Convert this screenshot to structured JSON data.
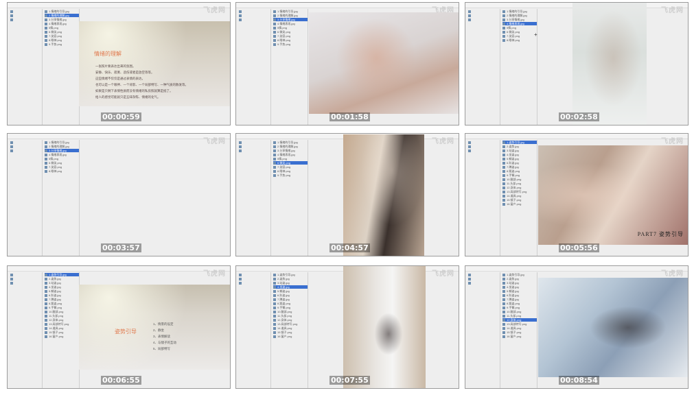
{
  "watermark": "飞虎网",
  "frames": [
    {
      "timestamp": "00:00:59",
      "tree": [
        "1.情绪的引导.jpg",
        "2.情绪的理解.jpg",
        "3.分享情绪.jpg",
        "4.情绪表现.jpg",
        "5情.png",
        "6.微笑.png",
        "7.笑容.png",
        "8.眼神.png",
        "9.手势.png"
      ],
      "slide": {
        "title": "情绪的理解",
        "lines": [
          "一张照片要表达出来的氛围。",
          "安静、快乐、寂寞、悲伤或者是放空等等。",
          "这些情绪不仅仅是通过表情的表达。",
          "也可以是一个眼神、一个背影、一个局部特写、一种气质的散发等。",
          "如果是只剩下表情性质而没有情绪的私房照就算是抵了。",
          "给人的感觉可能就只是五味杂陈、情绪的化气。"
        ]
      }
    },
    {
      "timestamp": "00:01:58",
      "tree": [
        "1.情绪的引导.jpg",
        "2.情绪的理解.jpg",
        "3.分享情绪.jpg",
        "4.情绪表现.jpg",
        "5情.png",
        "6.微笑.png",
        "7.笑容.png",
        "8.眼神.png",
        "9.手势.png"
      ]
    },
    {
      "timestamp": "00:02:58",
      "tree": [
        "1.情绪的引导.jpg",
        "2.情绪的理解.jpg",
        "3.分享情绪.jpg",
        "4.情绪表现.jpg",
        "5情.png",
        "6.微笑.png",
        "7.笑容.png",
        "8.眼神.png"
      ]
    },
    {
      "timestamp": "00:03:57",
      "tree": [
        "1.情绪的引导.jpg",
        "2.情绪的理解.jpg",
        "3.分享情绪.jpg",
        "4.情绪表现.jpg",
        "5情.png",
        "6.微笑.png",
        "7.笑容.png",
        "8.眼神.png"
      ]
    },
    {
      "timestamp": "00:04:57",
      "tree": [
        "1.情绪的引导.jpg",
        "2.情绪的理解.jpg",
        "3.分享情绪.jpg",
        "4.情绪表现.jpg",
        "5情.png",
        "6.微笑.png",
        "7.笑容.png",
        "8.眼神.png",
        "9.手势.png"
      ]
    },
    {
      "timestamp": "00:05:56",
      "tree": [
        "1.姿势引导.jpg",
        "2.姿势.jpg",
        "3.站姿.jpg",
        "4.坐姿.jpg",
        "5.躺姿.jpg",
        "6.趴姿.jpg",
        "7.蹲姿.jpg",
        "8.跪姿.png",
        "9.手臂.png",
        "10.腿部.png",
        "11.头部.png",
        "12.身体.png",
        "13.局部特写.png",
        "14.道具.png",
        "15.镜子.png",
        "16.窗户.png"
      ],
      "caption": "PART7 姿势引导"
    },
    {
      "timestamp": "00:06:55",
      "tree": [
        "1.姿势引导.jpg",
        "2.姿势.jpg",
        "3.站姿.jpg",
        "4.坐姿.jpg",
        "5.躺姿.jpg",
        "6.趴姿.jpg",
        "7.蹲姿.jpg",
        "8.跪姿.png",
        "9.手臂.png",
        "10.腿部.png",
        "11.头部.png",
        "12.身体.png",
        "13.局部特写.png",
        "14.道具.png",
        "15.镜子.png",
        "16.窗户.png"
      ],
      "slide": {
        "title": "姿势引导",
        "items": [
          "1、情景的设定",
          "2、静坐",
          "3、表情解读",
          "4、与镜子的互动",
          "5、局部特写"
        ]
      }
    },
    {
      "timestamp": "00:07:55",
      "tree": [
        "1.姿势引导.jpg",
        "2.姿势.jpg",
        "3.站姿.jpg",
        "4.坐姿.jpg",
        "5.躺姿.jpg",
        "6.趴姿.jpg",
        "7.蹲姿.jpg",
        "8.跪姿.png",
        "9.手臂.png",
        "10.腿部.png",
        "11.头部.png",
        "12.身体.png",
        "13.局部特写.png",
        "14.道具.png",
        "15.镜子.png",
        "16.窗户.png"
      ]
    },
    {
      "timestamp": "00:08:54",
      "tree": [
        "1.姿势引导.jpg",
        "2.姿势.jpg",
        "3.站姿.jpg",
        "4.坐姿.jpg",
        "5.躺姿.jpg",
        "6.趴姿.jpg",
        "7.蹲姿.jpg",
        "8.跪姿.png",
        "9.手臂.png",
        "10.腿部.png",
        "11.头部.png",
        "12.身体.png",
        "13.局部特写.png",
        "14.道具.png",
        "15.镜子.png",
        "16.窗户.png"
      ]
    }
  ],
  "colors": {
    "selection": "#3a6fd0",
    "slide_title": "#e07a4f",
    "frame_bg": "#eeeeee"
  }
}
